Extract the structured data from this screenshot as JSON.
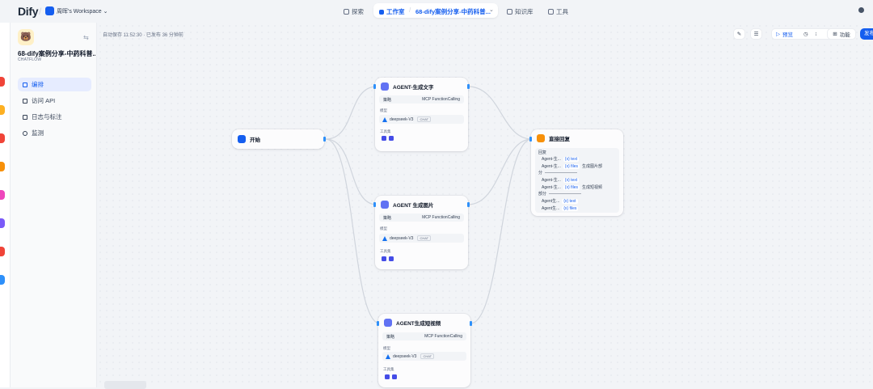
{
  "topbar": {
    "logo": "Dify",
    "workspace": "周晖's Workspace",
    "nav_explore": "探索",
    "nav_studio": "工作室",
    "app_name": "68-dify案例分享-中药科普...",
    "nav_knowledge": "知识库",
    "nav_tools": "工具"
  },
  "sidebar": {
    "app_title": "68-dify案例分享-中药科普...",
    "app_mode": "CHATFLOW",
    "menu": [
      {
        "label": "编排",
        "active": true
      },
      {
        "label": "访问 API",
        "active": false
      },
      {
        "label": "日志与标注",
        "active": false
      },
      {
        "label": "监测",
        "active": false
      }
    ]
  },
  "canvas": {
    "autosave": "自动保存 11:52:30 · 已发布 36 分钟前",
    "toolbar": {
      "preview": "预览",
      "features": "功能",
      "publish": "发布"
    }
  },
  "nodes": {
    "start": {
      "title": "开始"
    },
    "agent_text": {
      "title": "AGENT-生成文字",
      "strategy_label": "策略",
      "strategy_value": "MCP FunctionCalling",
      "model_label": "模型",
      "model_name": "deepseek-V3",
      "model_tag": "CHAT",
      "tools_label": "工具集"
    },
    "agent_image": {
      "title": "AGENT 生成图片",
      "strategy_label": "策略",
      "strategy_value": "MCP FunctionCalling",
      "model_label": "模型",
      "model_name": "deepseek-V3",
      "model_tag": "CHAT",
      "tools_label": "工具集"
    },
    "agent_video": {
      "title": "AGENT生成短视频",
      "strategy_label": "策略",
      "strategy_value": "MCP FunctionCalling",
      "model_label": "模型",
      "model_name": "deepseek-V3",
      "model_tag": "CHAT",
      "tools_label": "工具集"
    },
    "answer": {
      "title": "直接回复",
      "reply_label": "回复",
      "lines": [
        {
          "node": "Agent-生...",
          "var": "{x} text",
          "suffix": ""
        },
        {
          "node": "Agent-生...",
          "var": "{x} files",
          "suffix": "生成图片部"
        },
        {
          "node": "分",
          "var": "",
          "suffix": "————————"
        },
        {
          "node": "Agent-生...",
          "var": "{x} text",
          "suffix": ""
        },
        {
          "node": "Agent-生...",
          "var": "{x} files",
          "suffix": "生成短视频"
        },
        {
          "node": "部分",
          "var": "",
          "suffix": "————————"
        },
        {
          "node": "Agent生...",
          "var": "{x} text",
          "suffix": ""
        },
        {
          "node": "Agent生...",
          "var": "{x} files",
          "suffix": ""
        }
      ]
    }
  }
}
